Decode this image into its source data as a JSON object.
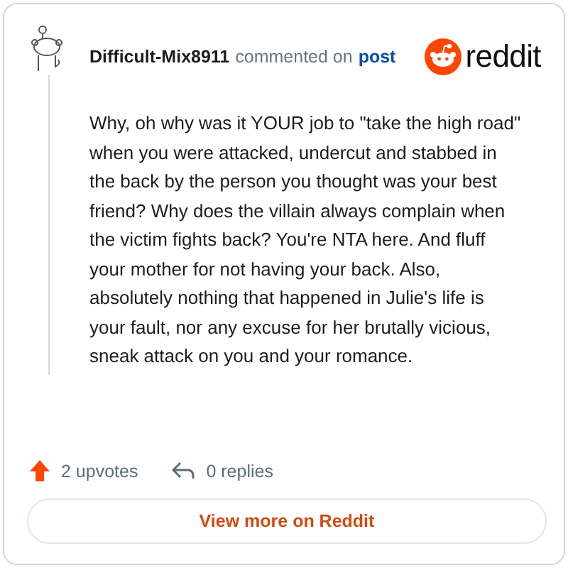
{
  "comment": {
    "author": "Difficult-Mix8911",
    "action": "commented on",
    "link": "post",
    "body": "Why, oh why was it YOUR job to \"take the high road\" when you were attacked, undercut and stabbed in the back by the person you thought was your best friend? Why does the villain always complain when the victim fights back? You're NTA here. And fluff your mother for not having your back. Also, absolutely nothing that happened in Julie's life is your fault, nor any excuse for her brutally vicious, sneak attack on you and your romance."
  },
  "brand": {
    "name": "reddit"
  },
  "stats": {
    "upvotes": "2 upvotes",
    "replies": "0 replies"
  },
  "button": {
    "label": "View more on Reddit"
  }
}
